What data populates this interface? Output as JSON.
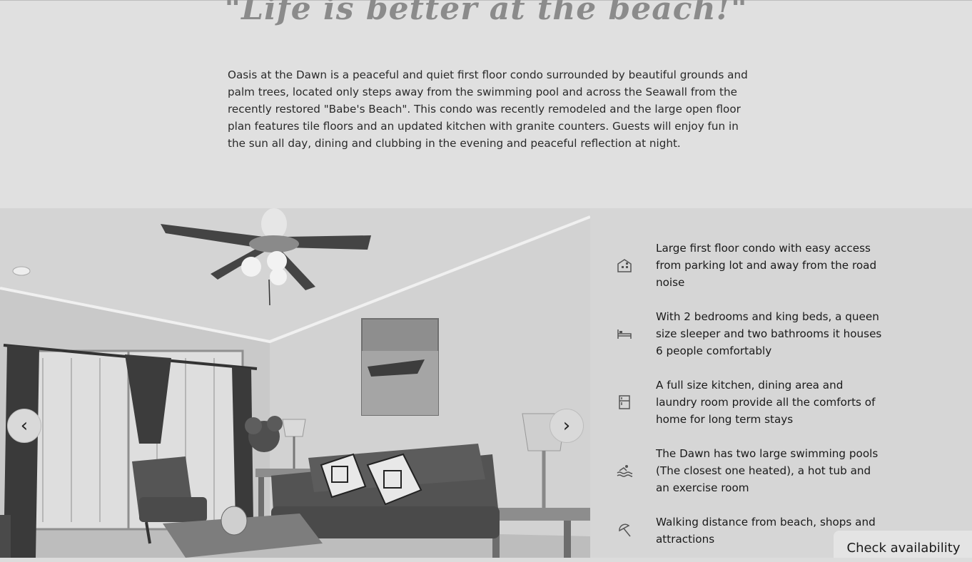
{
  "tagline": "\"Life is better at the beach!\"",
  "description": "Oasis at the Dawn is a peaceful and quiet first floor condo surrounded by beautiful grounds and palm trees, located only steps away from the swimming pool and across the Seawall from the recently restored \"Babe's Beach\". This condo was recently remodeled and the large open floor plan features tile floors and an updated kitchen with granite counters. Guests will enjoy fun in the sun all day, dining and clubbing in the evening and peaceful reflection at night.",
  "gallery": {
    "prev_icon": "chevron-left-icon",
    "next_icon": "chevron-right-icon"
  },
  "features": [
    {
      "icon": "building-icon",
      "text": "Large first floor condo with easy access from parking lot and away from the road noise"
    },
    {
      "icon": "bed-icon",
      "text": "With 2 bedrooms and king beds, a queen size sleeper and two bathrooms it houses 6 people comfortably"
    },
    {
      "icon": "fridge-icon",
      "text": "A full size kitchen, dining area and laundry room provide all the comforts of home for long term stays"
    },
    {
      "icon": "pool-icon",
      "text": "The Dawn has two large swimming pools (The closest one heated), a hot tub and an exercise room"
    },
    {
      "icon": "beach-umbrella-icon",
      "text": "Walking distance from beach, shops and attractions"
    }
  ],
  "cta": {
    "label": "Check availability"
  }
}
